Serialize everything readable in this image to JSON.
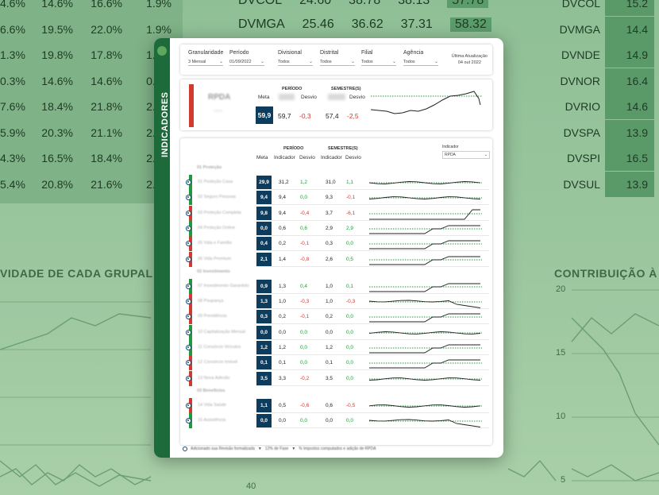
{
  "background": {
    "left_table": [
      [
        "4.6%",
        "14.6%",
        "16.6%",
        "1.9%"
      ],
      [
        "6.6%",
        "19.5%",
        "22.0%",
        "1.9%"
      ],
      [
        "1.3%",
        "19.8%",
        "17.8%",
        "1.4%"
      ],
      [
        "0.3%",
        "14.6%",
        "14.6%",
        "0.0%"
      ],
      [
        "7.6%",
        "18.4%",
        "21.8%",
        "2.4%"
      ],
      [
        "5.9%",
        "20.3%",
        "21.1%",
        "2.4%"
      ],
      [
        "4.3%",
        "16.5%",
        "18.4%",
        "2.4%"
      ],
      [
        "5.4%",
        "20.8%",
        "21.6%",
        "2.4%"
      ]
    ],
    "mid_rows": [
      {
        "name": "DVCOL",
        "v1": "24.60",
        "v2": "38.78",
        "v3": "38.13",
        "v4": "57.78"
      },
      {
        "name": "DVMGA",
        "v1": "25.46",
        "v2": "36.62",
        "v3": "37.31",
        "v4": "58.32"
      }
    ],
    "right_table": [
      {
        "name": "DVCOL",
        "value": "15.2"
      },
      {
        "name": "DVMGA",
        "value": "14.4"
      },
      {
        "name": "DVNDE",
        "value": "14.9"
      },
      {
        "name": "DVNOR",
        "value": "16.4"
      },
      {
        "name": "DVRIO",
        "value": "14.6"
      },
      {
        "name": "DVSPA",
        "value": "13.9"
      },
      {
        "name": "DVSPI",
        "value": "16.5"
      },
      {
        "name": "DVSUL",
        "value": "13.9"
      }
    ],
    "left_heading": "VIDADE DE CADA GRUPAL",
    "right_heading": "CONTRIBUIÇÃO À",
    "right_axis": [
      "20",
      "15",
      "10",
      "5"
    ],
    "mid_axis_label": "40"
  },
  "sidebar": {
    "title": "INDICADORES"
  },
  "filters": [
    {
      "label": "Granularidade",
      "value": "3 Mensal"
    },
    {
      "label": "Período",
      "value": "01/09/2022"
    },
    {
      "label": "Divisional",
      "value": "Todos"
    },
    {
      "label": "Distrital",
      "value": "Todos"
    },
    {
      "label": "Filial",
      "value": "Todos"
    },
    {
      "label": "Agência",
      "value": "Todos"
    }
  ],
  "last_update": {
    "label": "Última Atualização",
    "date": "04 out 2022"
  },
  "summary": {
    "name": "RPDA",
    "headers": {
      "period": "PERÍODO",
      "semester": "SEMESTRE(S)",
      "meta": "Meta",
      "desvio": "Desvio"
    },
    "meta": "59,9",
    "period_value": "59,7",
    "period_desvio": "-0,3",
    "semester_value": "57,4",
    "semester_desvio": "-2,5"
  },
  "table": {
    "headers": {
      "period": "PERÍODO",
      "semester": "SEMESTRE(S)",
      "meta": "Meta",
      "indicador": "Indicador",
      "desvio": "Desvio"
    },
    "indicator_select": {
      "label": "Indicador",
      "value": "RPDA"
    },
    "groups": [
      {
        "title": "01 Proteção",
        "rows": [
          {
            "name": "01 Proteção Casa",
            "meta": "29,9",
            "ind": "31,2",
            "dev": "1,2",
            "sind": "31,0",
            "sdev": "1,1",
            "color": "#22983d"
          },
          {
            "name": "02 Seguro Pessoas",
            "meta": "9,4",
            "ind": "9,4",
            "dev": "0,0",
            "sind": "9,3",
            "sdev": "-0,1",
            "color": "#22983d"
          },
          {
            "name": "03 Proteção Completa",
            "meta": "9,8",
            "ind": "9,4",
            "dev": "-0,4",
            "sind": "3,7",
            "sdev": "-6,1",
            "color": "#d23a2f"
          },
          {
            "name": "04 Proteção Online",
            "meta": "0,0",
            "ind": "0,6",
            "dev": "0,6",
            "sind": "2,9",
            "sdev": "2,9",
            "color": "#22983d"
          },
          {
            "name": "05 Vida e Família",
            "meta": "0,4",
            "ind": "0,2",
            "dev": "-0,1",
            "sind": "0,3",
            "sdev": "0,0",
            "color": "#d23a2f"
          },
          {
            "name": "06 Vida Premium",
            "meta": "2,1",
            "ind": "1,4",
            "dev": "-0,8",
            "sind": "2,6",
            "sdev": "0,5",
            "color": "#d23a2f"
          }
        ]
      },
      {
        "title": "02 Investimento",
        "rows": [
          {
            "name": "07 Investimento Garantido",
            "meta": "0,9",
            "ind": "1,3",
            "dev": "0,4",
            "sind": "1,0",
            "sdev": "0,1",
            "color": "#22983d"
          },
          {
            "name": "08 Poupança",
            "meta": "1,3",
            "ind": "1,0",
            "dev": "-0,3",
            "sind": "1,0",
            "sdev": "-0,3",
            "color": "#d23a2f"
          },
          {
            "name": "09 Previdência",
            "meta": "0,3",
            "ind": "0,2",
            "dev": "-0,1",
            "sind": "0,2",
            "sdev": "0,0",
            "color": "#d23a2f"
          },
          {
            "name": "10 Capitalização Mensal",
            "meta": "0,0",
            "ind": "0,0",
            "dev": "0,0",
            "sind": "0,0",
            "sdev": "0,0",
            "color": "#22983d"
          },
          {
            "name": "11 Consórcio Veículos",
            "meta": "1,2",
            "ind": "1,2",
            "dev": "0,0",
            "sind": "1,2",
            "sdev": "0,0",
            "color": "#22983d"
          },
          {
            "name": "12 Consórcio Imóvel",
            "meta": "0,1",
            "ind": "0,1",
            "dev": "0,0",
            "sind": "0,1",
            "sdev": "0,0",
            "color": "#d23a2f"
          },
          {
            "name": "13 Nova Adesão",
            "meta": "3,5",
            "ind": "3,3",
            "dev": "-0,2",
            "sind": "3,5",
            "sdev": "0,0",
            "color": "#d23a2f"
          }
        ]
      },
      {
        "title": "03 Benefícios",
        "rows": [
          {
            "name": "14 Vida Saúde",
            "meta": "1,1",
            "ind": "0,5",
            "dev": "-0,6",
            "sind": "0,6",
            "sdev": "-0,5",
            "color": "#d23a2f"
          },
          {
            "name": "15 Assistência",
            "meta": "0,0",
            "ind": "0,0",
            "dev": "0,0",
            "sind": "0,0",
            "sdev": "0,0",
            "color": "#22983d"
          }
        ]
      }
    ]
  },
  "footnote": {
    "a": "Adicionado sua Revisão formalizada",
    "b": "12% de Fase",
    "c": "% Impostos computados e adição de RPDA"
  },
  "colors": {
    "meta_box": "#0d3d5e",
    "positive": "#22983d",
    "negative": "#d23a2f",
    "sidebar": "#1d6b3a"
  }
}
